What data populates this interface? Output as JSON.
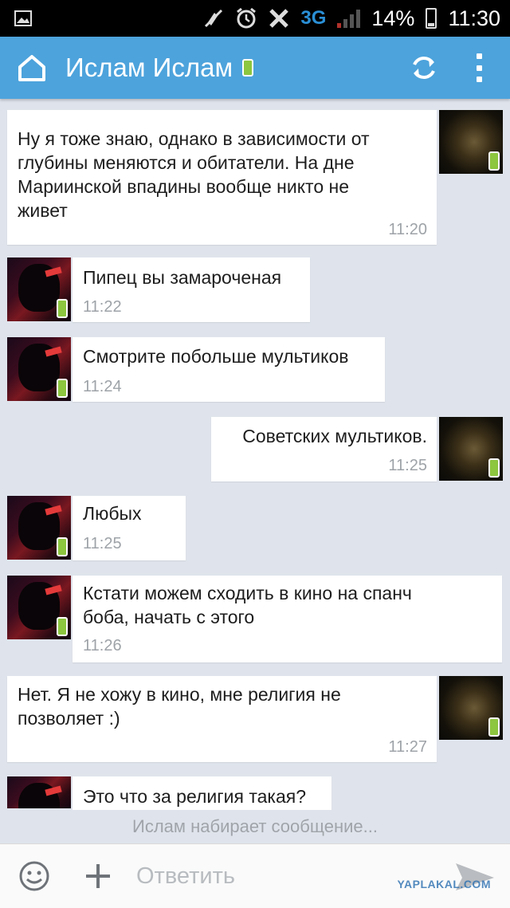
{
  "status_bar": {
    "network": "3G",
    "battery": "14%",
    "time": "11:30"
  },
  "header": {
    "title": "Ислам Ислам"
  },
  "messages": [
    {
      "side": "outgoing",
      "text_lines": [
        "Ну я тоже знаю, однако в зависимости от",
        "глубины меняются и обитатели. На дне",
        "Мариинской впадины вообще никто не",
        "живет"
      ],
      "time": "11:20"
    },
    {
      "side": "incoming",
      "text_lines": [
        "Пипец вы замароченая"
      ],
      "time": "11:22"
    },
    {
      "side": "incoming",
      "text_lines": [
        "Смотрите побольше мультиков"
      ],
      "time": "11:24"
    },
    {
      "side": "outgoing",
      "text_lines": [
        "Советских мультиков."
      ],
      "time": "11:25"
    },
    {
      "side": "incoming",
      "text_lines": [
        "Любых"
      ],
      "time": "11:25"
    },
    {
      "side": "incoming",
      "text_lines": [
        "Кстати можем сходить в кино на спанч",
        "боба, начать с этого"
      ],
      "time": "11:26"
    },
    {
      "side": "outgoing",
      "text_lines": [
        "Нет. Я не хожу в кино, мне религия не",
        "позволяет :)"
      ],
      "time": "11:27"
    },
    {
      "side": "incoming",
      "text_lines": [
        "Это что за религия такая?"
      ],
      "time": ""
    }
  ],
  "typing_indicator": "Ислам набирает сообщение...",
  "composer": {
    "placeholder": "Ответить"
  },
  "watermark": "YAPLAKAL.COM",
  "colors": {
    "app_bar": "#4da3dc",
    "chat_background": "#dfe4ec",
    "bubble": "#ffffff",
    "timestamp": "#9ea3a8",
    "online_badge": "#8dc63f"
  },
  "icons": {
    "home": "home-icon",
    "refresh": "refresh-icon",
    "menu": "overflow-menu-icon",
    "smile": "smile-icon",
    "attach": "plus-icon",
    "send": "send-icon"
  }
}
